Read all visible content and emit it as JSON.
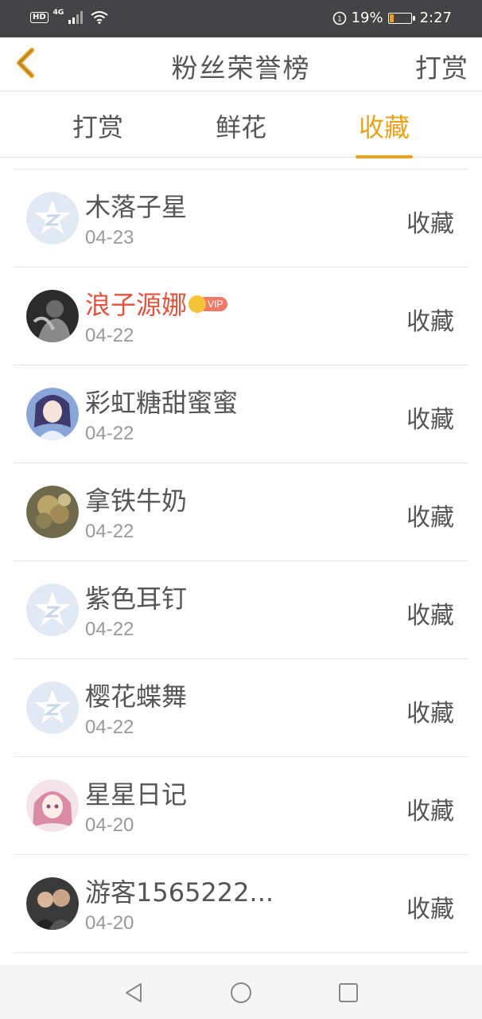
{
  "status_bar": {
    "hd": "HD",
    "network": "4G",
    "battery_percent": "19%",
    "battery_level": 0.19,
    "time": "2:27"
  },
  "nav": {
    "title": "粉丝荣誉榜",
    "right_action": "打赏"
  },
  "tabs": [
    {
      "label": "打赏",
      "active": false
    },
    {
      "label": "鲜花",
      "active": false
    },
    {
      "label": "收藏",
      "active": true
    }
  ],
  "list": [
    {
      "name": "木落子星",
      "date": "04-23",
      "action": "收藏",
      "vip": false,
      "avatar": "default-avatar-icon"
    },
    {
      "name": "浪子源娜",
      "date": "04-22",
      "action": "收藏",
      "vip": true,
      "vip_label": "VIP",
      "avatar": "user-photo"
    },
    {
      "name": "彩虹糖甜蜜蜜",
      "date": "04-22",
      "action": "收藏",
      "vip": false,
      "avatar": "anime-girl-photo"
    },
    {
      "name": "拿铁牛奶",
      "date": "04-22",
      "action": "收藏",
      "vip": false,
      "avatar": "flower-photo"
    },
    {
      "name": "紫色耳钉",
      "date": "04-22",
      "action": "收藏",
      "vip": false,
      "avatar": "default-avatar-icon"
    },
    {
      "name": "樱花蝶舞",
      "date": "04-22",
      "action": "收藏",
      "vip": false,
      "avatar": "default-avatar-icon"
    },
    {
      "name": "星星日记",
      "date": "04-20",
      "action": "收藏",
      "vip": false,
      "avatar": "anime-girl-pink-photo"
    },
    {
      "name": "游客1565222...",
      "date": "04-20",
      "action": "收藏",
      "vip": false,
      "avatar": "family-photo"
    }
  ],
  "colors": {
    "accent": "#e9a21b",
    "vip_name": "#e2533d",
    "status_bar": "#444446"
  }
}
